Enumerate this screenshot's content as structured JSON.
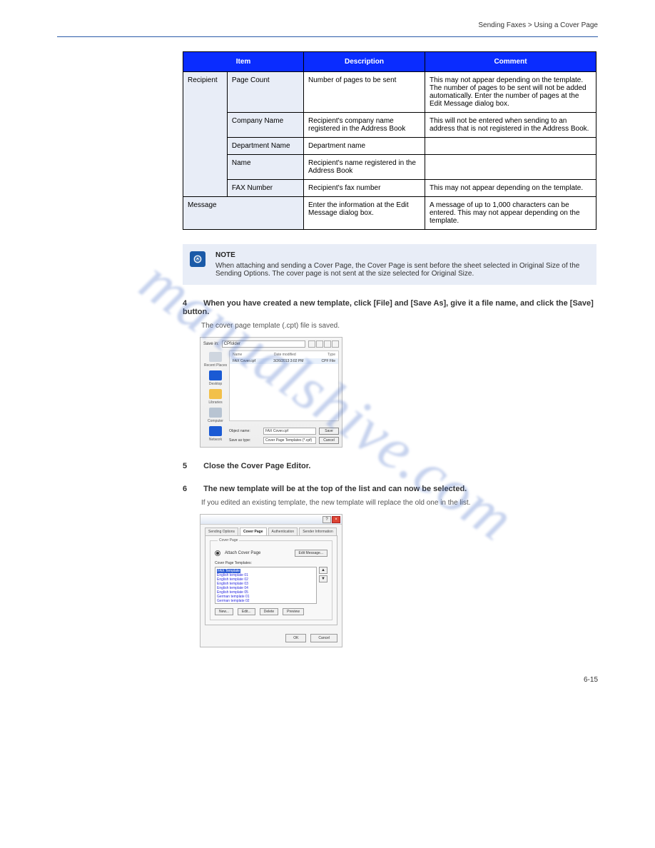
{
  "header": {
    "breadcrumb": "Sending Faxes > Using a Cover Page"
  },
  "table": {
    "headers": [
      "Item",
      "Description",
      "Comment"
    ],
    "rows": [
      {
        "cells": [
          {
            "text": "Recipient",
            "rowspan": 5,
            "light": true
          },
          {
            "text": "Page Count",
            "light": true
          },
          {
            "text": "Number of pages to be sent"
          },
          {
            "text": "This may not appear depending on the template. The number of pages to be sent will not be added automatically. Enter the number of pages at the Edit Message dialog box."
          }
        ]
      },
      {
        "cells": [
          {
            "text": "Company Name",
            "light": true
          },
          {
            "text": "Recipient's company name registered in the Address Book"
          },
          {
            "text": "This will not be entered when sending to an address that is not registered in the Address Book."
          }
        ]
      },
      {
        "cells": [
          {
            "text": "Department Name",
            "light": true
          },
          {
            "text": "Department name"
          },
          {
            "text": ""
          }
        ]
      },
      {
        "cells": [
          {
            "text": "Name",
            "light": true
          },
          {
            "text": "Recipient's name registered in the Address Book"
          },
          {
            "text": ""
          }
        ]
      },
      {
        "cells": [
          {
            "text": "FAX Number",
            "light": true
          },
          {
            "text": "Recipient's fax number"
          },
          {
            "text": "This may not appear depending on the template."
          }
        ]
      },
      {
        "cells": [
          {
            "text": "Message",
            "colspan": 2,
            "light": true
          },
          {
            "text": "Enter the information at the Edit Message dialog box."
          },
          {
            "text": "A message of up to 1,000 characters can be entered. This may not appear depending on the template."
          }
        ]
      }
    ]
  },
  "note": {
    "bold": "NOTE",
    "text": "When attaching and sending a Cover Page, the Cover Page is sent before the sheet selected in Original Size of the Sending Options. The cover page is not sent at the size selected for Original Size."
  },
  "step4": {
    "num": "4",
    "text": "When you have created a new template, click [File] and [Save As], give it a file name, and click the [Save] button.",
    "sub": "The cover page template (.cpt) file is saved."
  },
  "dlg1": {
    "saveInLabel": "Save in:",
    "saveInValue": "CPfolder",
    "colName": "Name",
    "colDate": "Date modified",
    "colType": "Type",
    "fileName": "FAX Cover.cpf",
    "fileDate": "3/26/2013 3:02 PM",
    "fileType": "CPF File",
    "places": [
      {
        "label": "Recent Places",
        "color": "#cfd6df"
      },
      {
        "label": "Desktop",
        "color": "#1a5ad4"
      },
      {
        "label": "Libraries",
        "color": "#f2c04a"
      },
      {
        "label": "Computer",
        "color": "#b8c4d2"
      },
      {
        "label": "Network",
        "color": "#1a5ad4"
      }
    ],
    "objNameLabel": "Object name:",
    "objNameValue": "FAX Cover.cpf",
    "saveTypeLabel": "Save as type:",
    "saveTypeValue": "Cover Page Templates (*.cpf)",
    "saveBtn": "Save",
    "cancelBtn": "Cancel"
  },
  "step5": {
    "num": "5",
    "text": "Close the Cover Page Editor."
  },
  "step6": {
    "num": "6",
    "text": "The new template will be at the top of the list and can now be selected.",
    "sub": "If you edited an existing template, the new template will replace the old one in the list."
  },
  "dlg2": {
    "tabs": [
      "Sending Options",
      "Cover Page",
      "Authentication",
      "Sender Information"
    ],
    "activeTab": 1,
    "groupTitle": "Cover Page",
    "attach": "Attach Cover Page",
    "editMsg": "Edit Message...",
    "listLabel": "Cover Page Templates:",
    "items": [
      "FAX Template",
      "English template 01",
      "English template 02",
      "English template 03",
      "English template 04",
      "English template 05",
      "German template 01",
      "German template 02"
    ],
    "newBtn": "New...",
    "editBtn": "Edit...",
    "deleteBtn": "Delete",
    "previewBtn": "Preview",
    "okBtn": "OK",
    "cancelBtn": "Cancel"
  },
  "page_number": "6-15",
  "watermark": "manualshive.com"
}
